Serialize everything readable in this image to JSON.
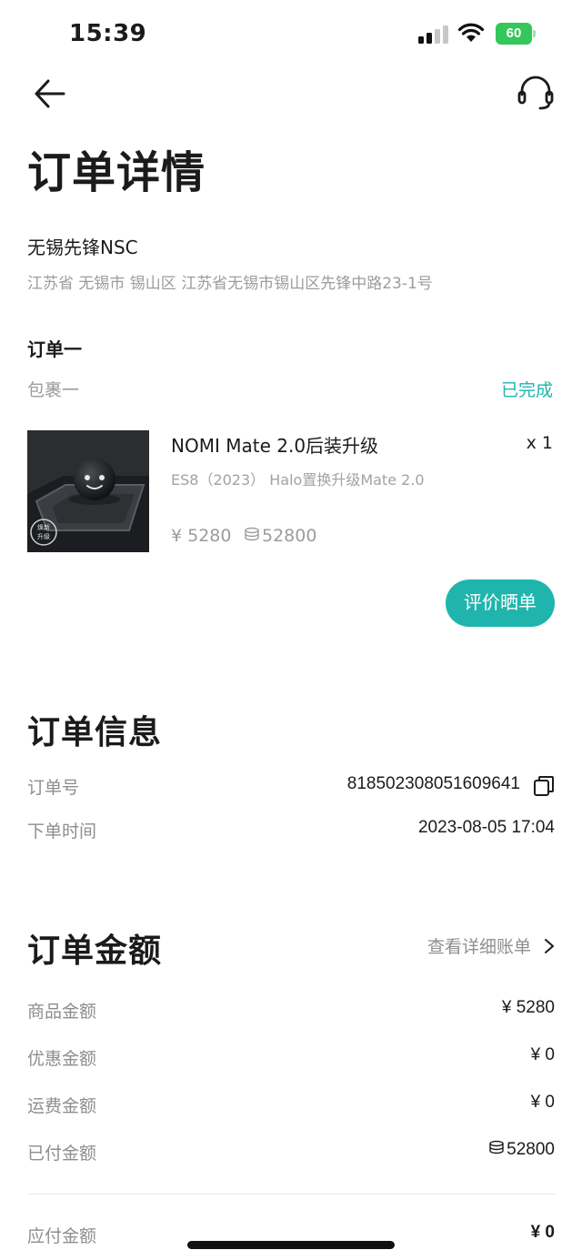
{
  "status_bar": {
    "time": "15:39",
    "battery": "60"
  },
  "header": {
    "title": "订单详情"
  },
  "store": {
    "name": "无锡先锋NSC",
    "address": "江苏省 无锡市 锡山区 江苏省无锡市锡山区先锋中路23-1号"
  },
  "order": {
    "label": "订单一",
    "package_label": "包裹一",
    "status": "已完成",
    "product": {
      "name": "NOMI Mate 2.0后装升级",
      "quantity": "x 1",
      "spec": "ES8（2023） Halo置换升级Mate 2.0",
      "price": "¥ 5280",
      "points": "52800",
      "image_badge_line1": "焕新",
      "image_badge_line2": "升级"
    },
    "review_button": "评价晒单"
  },
  "order_info": {
    "title": "订单信息",
    "order_no_label": "订单号",
    "order_no": "818502308051609641",
    "time_label": "下单时间",
    "time": "2023-08-05 17:04"
  },
  "amount": {
    "title": "订单金额",
    "bill_link": "查看详细账单",
    "goods_label": "商品金额",
    "goods_value": "¥ 5280",
    "discount_label": "优惠金额",
    "discount_value": "¥ 0",
    "shipping_label": "运费金额",
    "shipping_value": "¥ 0",
    "paid_label": "已付金额",
    "paid_value": "52800",
    "payable_label": "应付金额",
    "payable_value": "¥ 0"
  },
  "colors": {
    "accent": "#1fb5ad",
    "battery": "#34c759",
    "text": "#1b1b1b",
    "muted": "#8e8e8e"
  },
  "icons": [
    "back-arrow-icon",
    "headset-icon",
    "copy-icon",
    "chevron-right-icon",
    "coin-stack-icon",
    "wifi-icon",
    "signal-icon",
    "battery-icon"
  ]
}
